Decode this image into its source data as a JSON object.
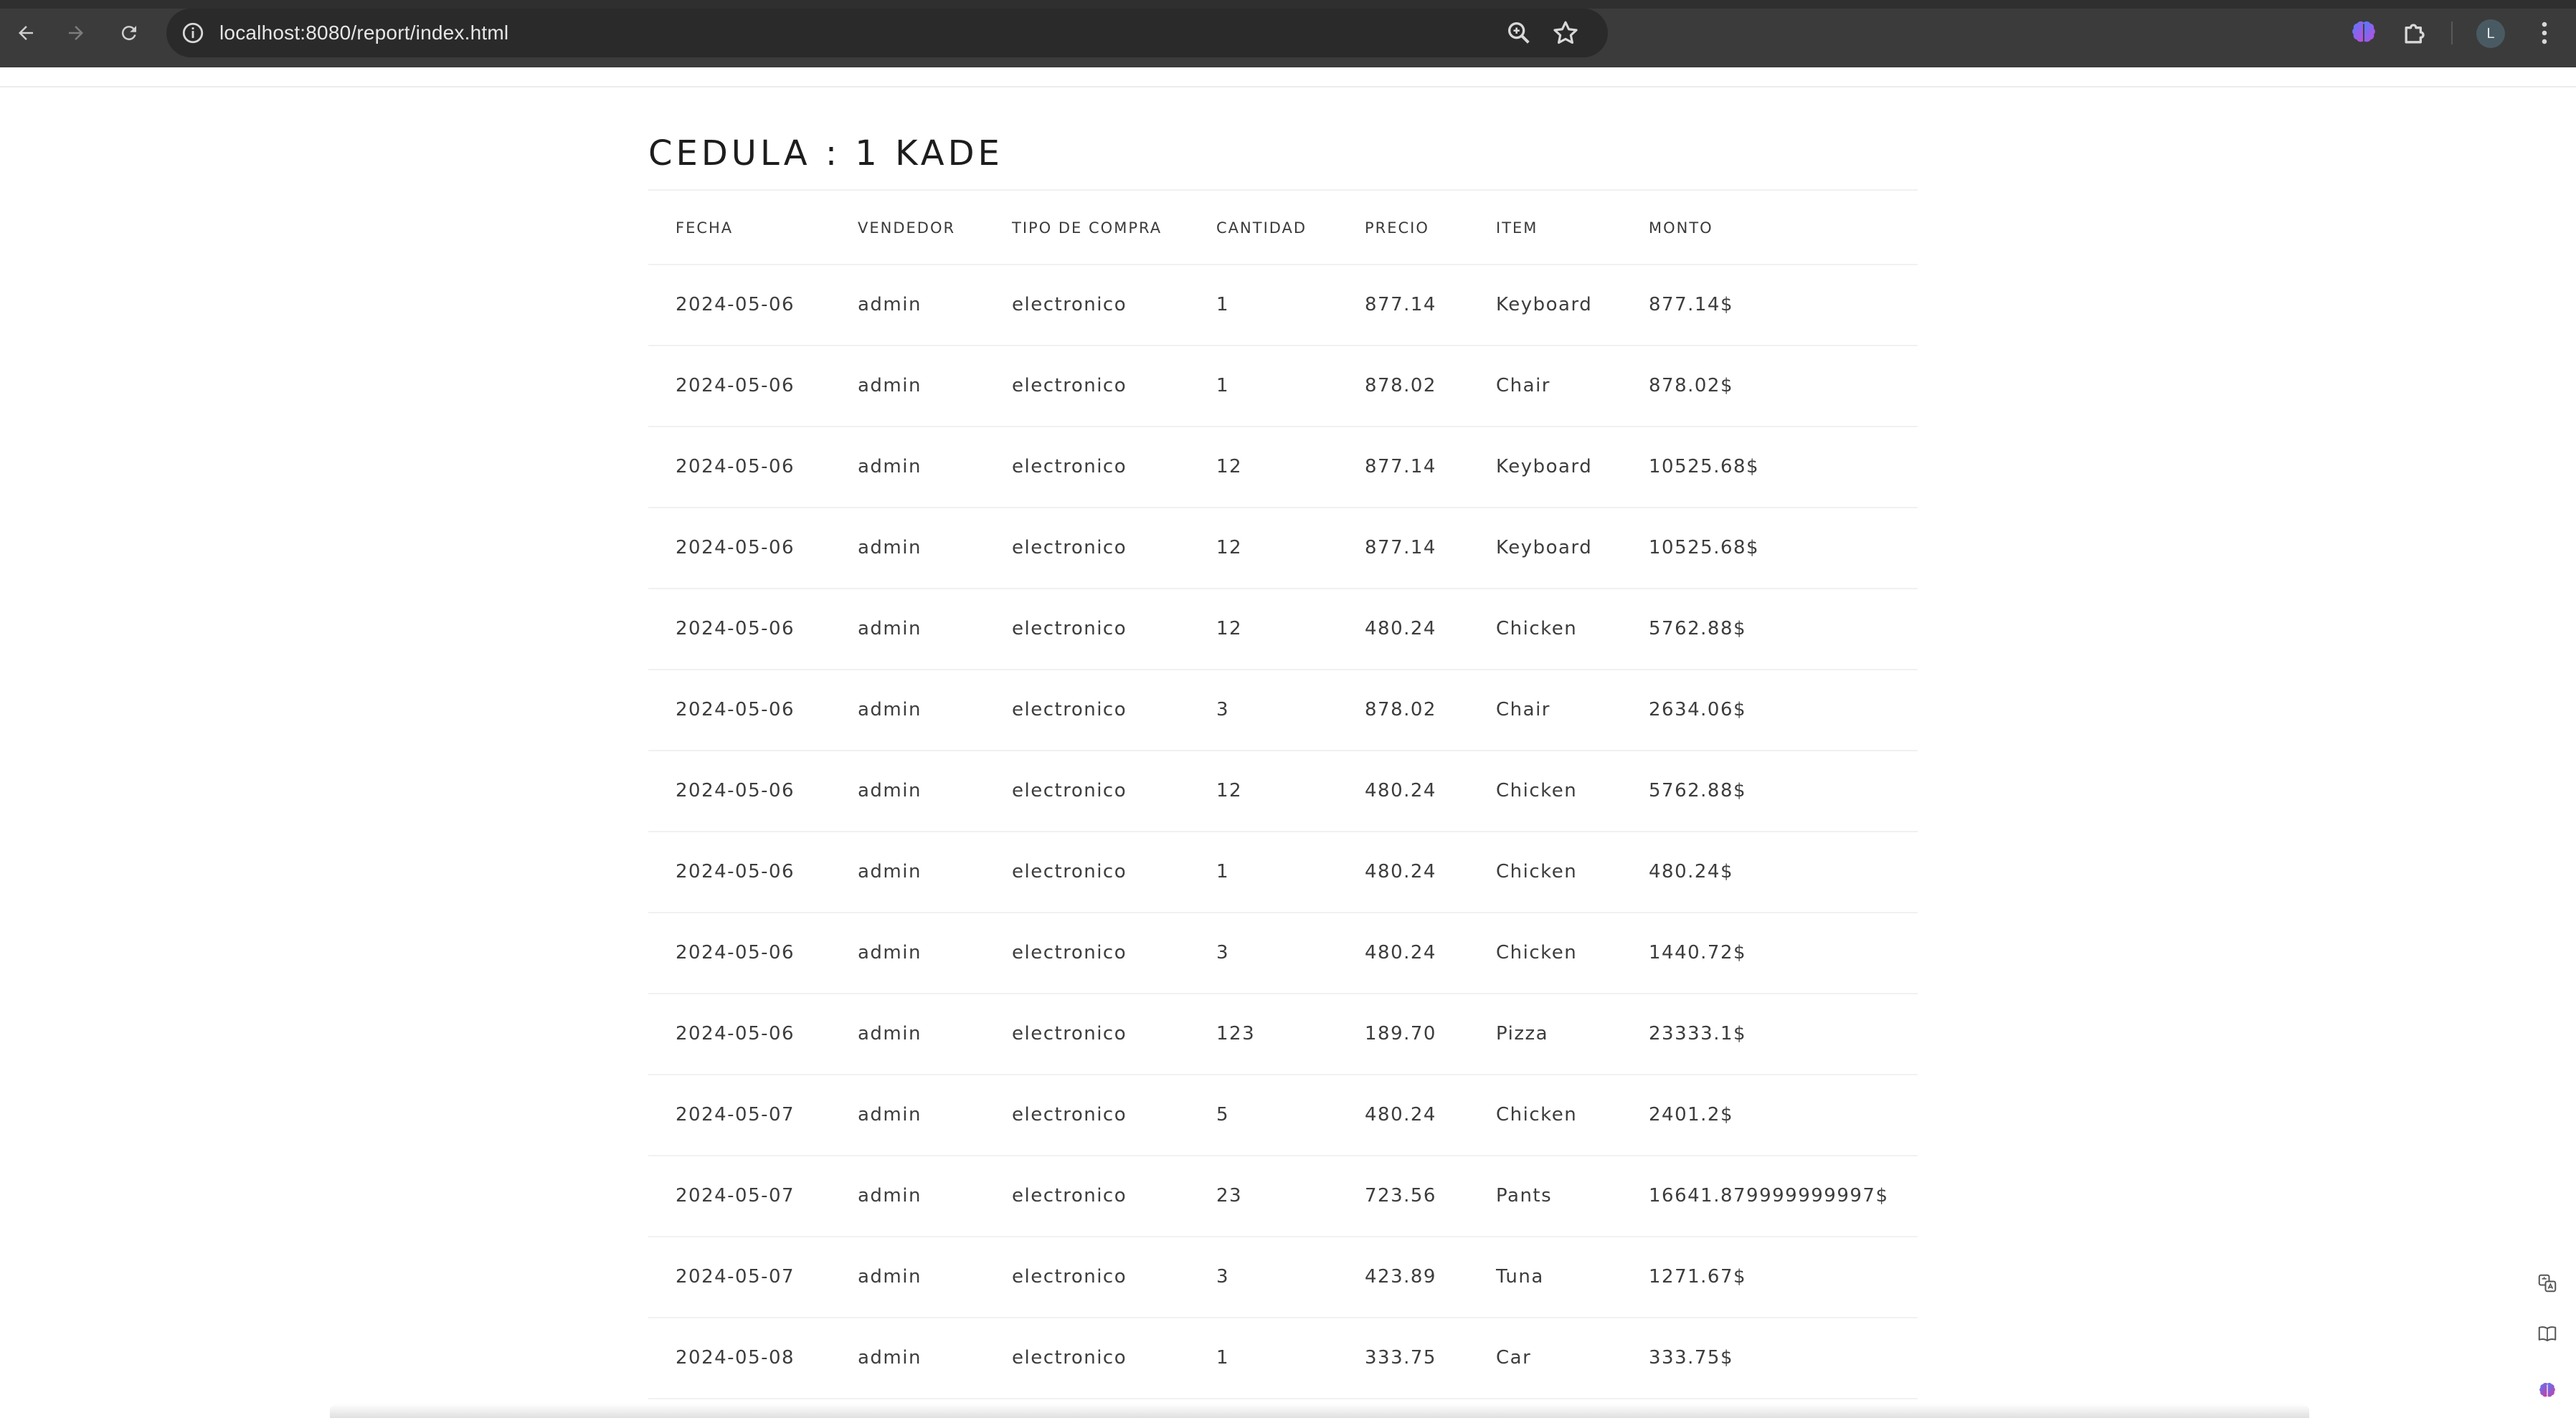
{
  "browser": {
    "url": "localhost:8080/report/index.html",
    "avatar_letter": "L",
    "icons": {
      "back": "arrow-left-icon",
      "forward": "arrow-right-icon",
      "reload": "reload-icon",
      "site_info": "info-icon",
      "zoom": "zoom-icon",
      "bookmark": "star-icon",
      "extension_ai": "brain-icon",
      "extensions": "puzzle-icon",
      "menu": "kebab-menu-icon"
    }
  },
  "report": {
    "title": "CEDULA : 1 KADE",
    "columns": [
      "FECHA",
      "VENDEDOR",
      "TIPO DE COMPRA",
      "CANTIDAD",
      "PRECIO",
      "ITEM",
      "MONTO"
    ],
    "rows": [
      [
        "2024-05-06",
        "admin",
        "electronico",
        "1",
        "877.14",
        "Keyboard",
        "877.14$"
      ],
      [
        "2024-05-06",
        "admin",
        "electronico",
        "1",
        "878.02",
        "Chair",
        "878.02$"
      ],
      [
        "2024-05-06",
        "admin",
        "electronico",
        "12",
        "877.14",
        "Keyboard",
        "10525.68$"
      ],
      [
        "2024-05-06",
        "admin",
        "electronico",
        "12",
        "877.14",
        "Keyboard",
        "10525.68$"
      ],
      [
        "2024-05-06",
        "admin",
        "electronico",
        "12",
        "480.24",
        "Chicken",
        "5762.88$"
      ],
      [
        "2024-05-06",
        "admin",
        "electronico",
        "3",
        "878.02",
        "Chair",
        "2634.06$"
      ],
      [
        "2024-05-06",
        "admin",
        "electronico",
        "12",
        "480.24",
        "Chicken",
        "5762.88$"
      ],
      [
        "2024-05-06",
        "admin",
        "electronico",
        "1",
        "480.24",
        "Chicken",
        "480.24$"
      ],
      [
        "2024-05-06",
        "admin",
        "electronico",
        "3",
        "480.24",
        "Chicken",
        "1440.72$"
      ],
      [
        "2024-05-06",
        "admin",
        "electronico",
        "123",
        "189.70",
        "Pizza",
        "23333.1$"
      ],
      [
        "2024-05-07",
        "admin",
        "electronico",
        "5",
        "480.24",
        "Chicken",
        "2401.2$"
      ],
      [
        "2024-05-07",
        "admin",
        "electronico",
        "23",
        "723.56",
        "Pants",
        "16641.879999999997$"
      ],
      [
        "2024-05-07",
        "admin",
        "electronico",
        "3",
        "423.89",
        "Tuna",
        "1271.67$"
      ],
      [
        "2024-05-08",
        "admin",
        "electronico",
        "1",
        "333.75",
        "Car",
        "333.75$"
      ]
    ]
  },
  "side_tools": [
    "translate-icon",
    "reader-icon",
    "brain-icon"
  ]
}
